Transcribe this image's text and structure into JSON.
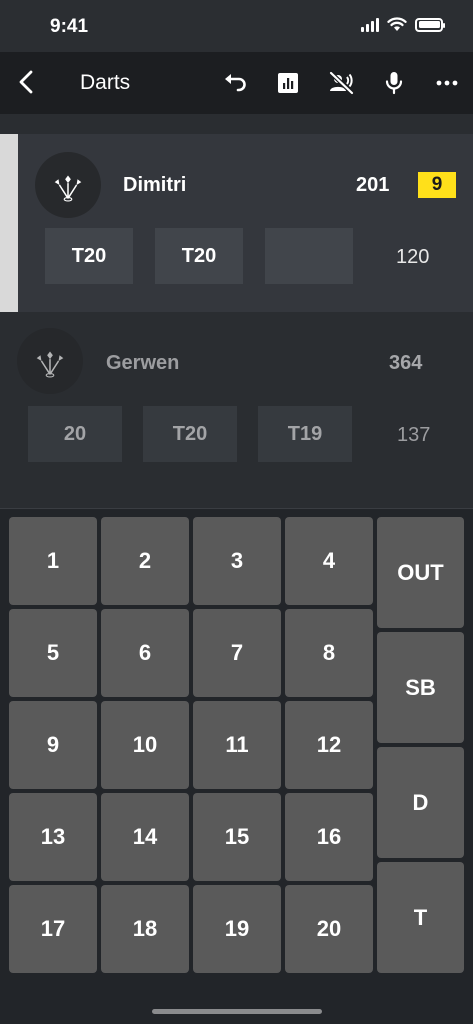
{
  "status_bar": {
    "time": "9:41"
  },
  "app_bar": {
    "title": "Darts",
    "actions": [
      "undo-icon",
      "stats-icon",
      "voice-off-icon",
      "mic-icon",
      "more-icon"
    ]
  },
  "players": [
    {
      "name": "Dimitri",
      "score": "201",
      "badge": "9",
      "throws": [
        "T20",
        "T20",
        ""
      ],
      "turn_total": "120",
      "active": true
    },
    {
      "name": "Gerwen",
      "score": "364",
      "throws": [
        "20",
        "T20",
        "T19"
      ],
      "turn_total": "137",
      "active": false
    }
  ],
  "keypad": {
    "numbers": [
      "1",
      "2",
      "3",
      "4",
      "5",
      "6",
      "7",
      "8",
      "9",
      "10",
      "11",
      "12",
      "13",
      "14",
      "15",
      "16",
      "17",
      "18",
      "19",
      "20"
    ],
    "side": [
      "OUT",
      "SB",
      "D",
      "T"
    ]
  },
  "colors": {
    "badge": "#ffe01a",
    "active_indicator": "#d9d9d9",
    "key": "#5a5a5a"
  }
}
